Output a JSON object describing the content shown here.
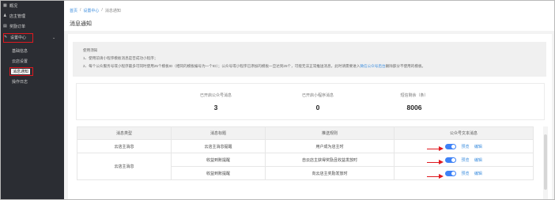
{
  "sidebar": {
    "items": [
      {
        "label": "概况",
        "icon": "grid-icon"
      },
      {
        "label": "店主管理",
        "icon": "user-icon"
      },
      {
        "label": "奖励订单",
        "icon": "order-icon"
      },
      {
        "label": "设置中心",
        "icon": "wrench-icon"
      }
    ],
    "sub_items": [
      {
        "label": "基础信息"
      },
      {
        "label": "云店设置"
      },
      {
        "label": "消息通知"
      },
      {
        "label": "操作日志"
      }
    ]
  },
  "breadcrumb": {
    "home": "首页",
    "sep": "/",
    "settings": "设置中心",
    "current": "消息通知"
  },
  "page_title": "消息通知",
  "notice": {
    "title": "使用须知",
    "line1": "1、使用前请小程序模板消息是否成功小程序；",
    "line2_a": "2、每个公众服务号或小程序最多可同时使用25个模板ID（相同的模板编号为一个ID）；公众号或小程序已添加的模板一旦达到25个，可能无法正常推送消息，此时请需要进入",
    "line2_link": "微信公众号后台",
    "line2_b": "删除部分不使用的模板。"
  },
  "stats": [
    {
      "label": "已开启公众号消息",
      "value": "3"
    },
    {
      "label": "已开启小程序消息",
      "value": "0"
    },
    {
      "label": "短信剩余（条）",
      "value": "8006"
    }
  ],
  "table": {
    "headers": [
      "消息类型",
      "消息标题",
      "推送规则",
      "公众号文本消息"
    ],
    "rows": [
      {
        "type": "云店主消息",
        "title": "云店主消息提醒",
        "rule": "用户成为店主时"
      },
      {
        "type": "云店主消息",
        "title": "收益到账提醒",
        "rule": "自云店主获得奖励且收益发放时"
      },
      {
        "type": "",
        "title": "收益到账提醒",
        "rule": "向云店主奖励发放时"
      }
    ],
    "preview_label": "预览",
    "edit_label": "编辑"
  },
  "colors": {
    "sidebar_bg": "#2b2d33",
    "accent": "#3e82f7",
    "highlight": "#e0191f"
  }
}
